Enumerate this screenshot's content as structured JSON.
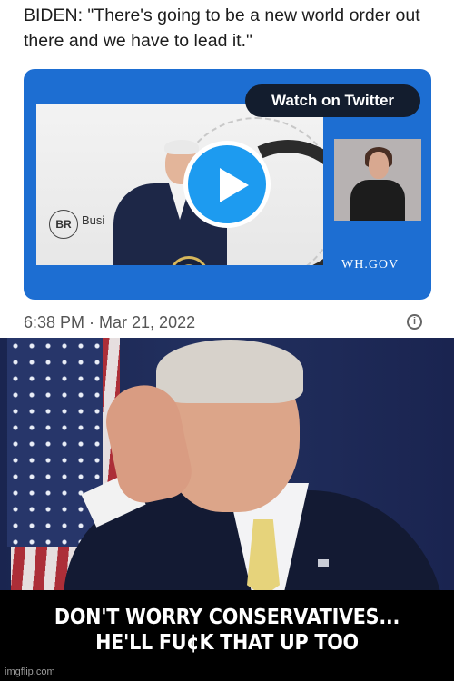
{
  "tweet": {
    "quote": "BIDEN: \"There's going to be a new world order out there and we have to lead it.\"",
    "timestamp": "6:38 PM · Mar 21, 2022",
    "info_icon": "info-icon"
  },
  "video": {
    "watch_label": "Watch on Twitter",
    "source_label": "WH.GOV",
    "logo_text": "BR",
    "logo_sub": "Busi",
    "accent_color": "#1d6ed2",
    "play_color": "#1d9bf0"
  },
  "meme": {
    "caption_line1": "DON'T WORRY CONSERVATIVES...",
    "caption_line2": "HE'LL FU¢K THAT UP TOO"
  },
  "watermark": "imgflip.com"
}
